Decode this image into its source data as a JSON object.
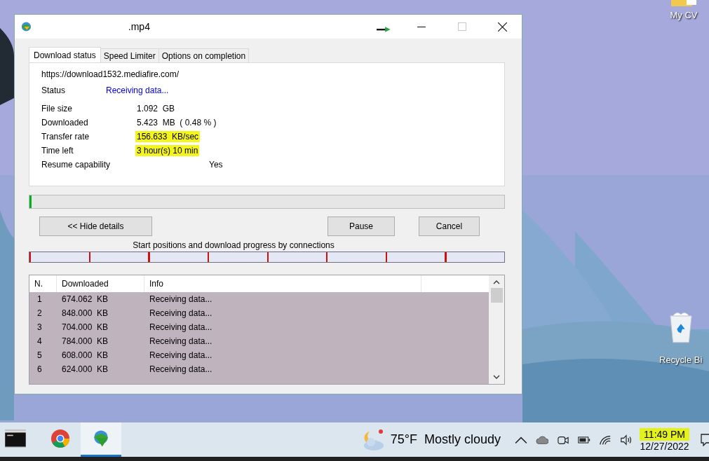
{
  "desktop": {
    "icons": [
      {
        "kind": "folder",
        "label": "My CV"
      },
      {
        "kind": "recycle",
        "label": "Recycle Bi"
      }
    ]
  },
  "window": {
    "title": ".mp4",
    "maximize_disabled": true
  },
  "tabs": [
    {
      "label": "Download status",
      "selected": true
    },
    {
      "label": "Speed Limiter",
      "selected": false
    },
    {
      "label": "Options on completion",
      "selected": false
    }
  ],
  "url": "https://download1532.mediafire.com/",
  "details": [
    {
      "kind": "status",
      "label": "Status",
      "value": "Receiving data...",
      "highlighted": false
    },
    {
      "kind": "field",
      "label": "File size",
      "value": "1.092  GB",
      "highlighted": false
    },
    {
      "kind": "field",
      "label": "Downloaded",
      "value": "5.423  MB  ( 0.48 % )",
      "highlighted": false
    },
    {
      "kind": "field",
      "label": "Transfer rate",
      "value": "156.633  KB/sec",
      "highlighted": true
    },
    {
      "kind": "field",
      "label": "Time left",
      "value": "3 hour(s) 10 min",
      "highlighted": true
    },
    {
      "kind": "resume",
      "label": "Resume capability",
      "value": "Yes",
      "highlighted": false
    }
  ],
  "progress": {
    "level": 0.005
  },
  "buttons": {
    "details": "<< Hide details",
    "pause": "Pause",
    "cancel": "Cancel"
  },
  "connections_caption": "Start positions and download progress by connections",
  "connection_segments": [
    {
      "level": 0.01
    },
    {
      "level": 0.01
    },
    {
      "level": 0.01
    },
    {
      "level": 0.01
    },
    {
      "level": 0.01
    },
    {
      "level": 0.01
    },
    {
      "level": 0.01
    },
    {
      "level": 0.01
    }
  ],
  "table": {
    "columns": [
      "N.",
      "Downloaded",
      "Info"
    ],
    "rows": [
      [
        "1",
        "674.062  KB",
        "Receiving data..."
      ],
      [
        "2",
        "848.000  KB",
        "Receiving data..."
      ],
      [
        "3",
        "704.000  KB",
        "Receiving data..."
      ],
      [
        "4",
        "784.000  KB",
        "Receiving data..."
      ],
      [
        "5",
        "608.000  KB",
        "Receiving data..."
      ],
      [
        "6",
        "624.000  KB",
        "Receiving data..."
      ]
    ]
  },
  "taskbar": {
    "apps": [
      {
        "kind": "terminal",
        "selected": false
      },
      {
        "kind": "chrome",
        "selected": false
      },
      {
        "kind": "downloader",
        "selected": true
      }
    ],
    "weather": {
      "temperature": "75°F",
      "condition": "Mostly cloudy"
    },
    "clock": {
      "time": "11:49 PM",
      "date": "12/27/2022",
      "highlighted": true
    }
  }
}
